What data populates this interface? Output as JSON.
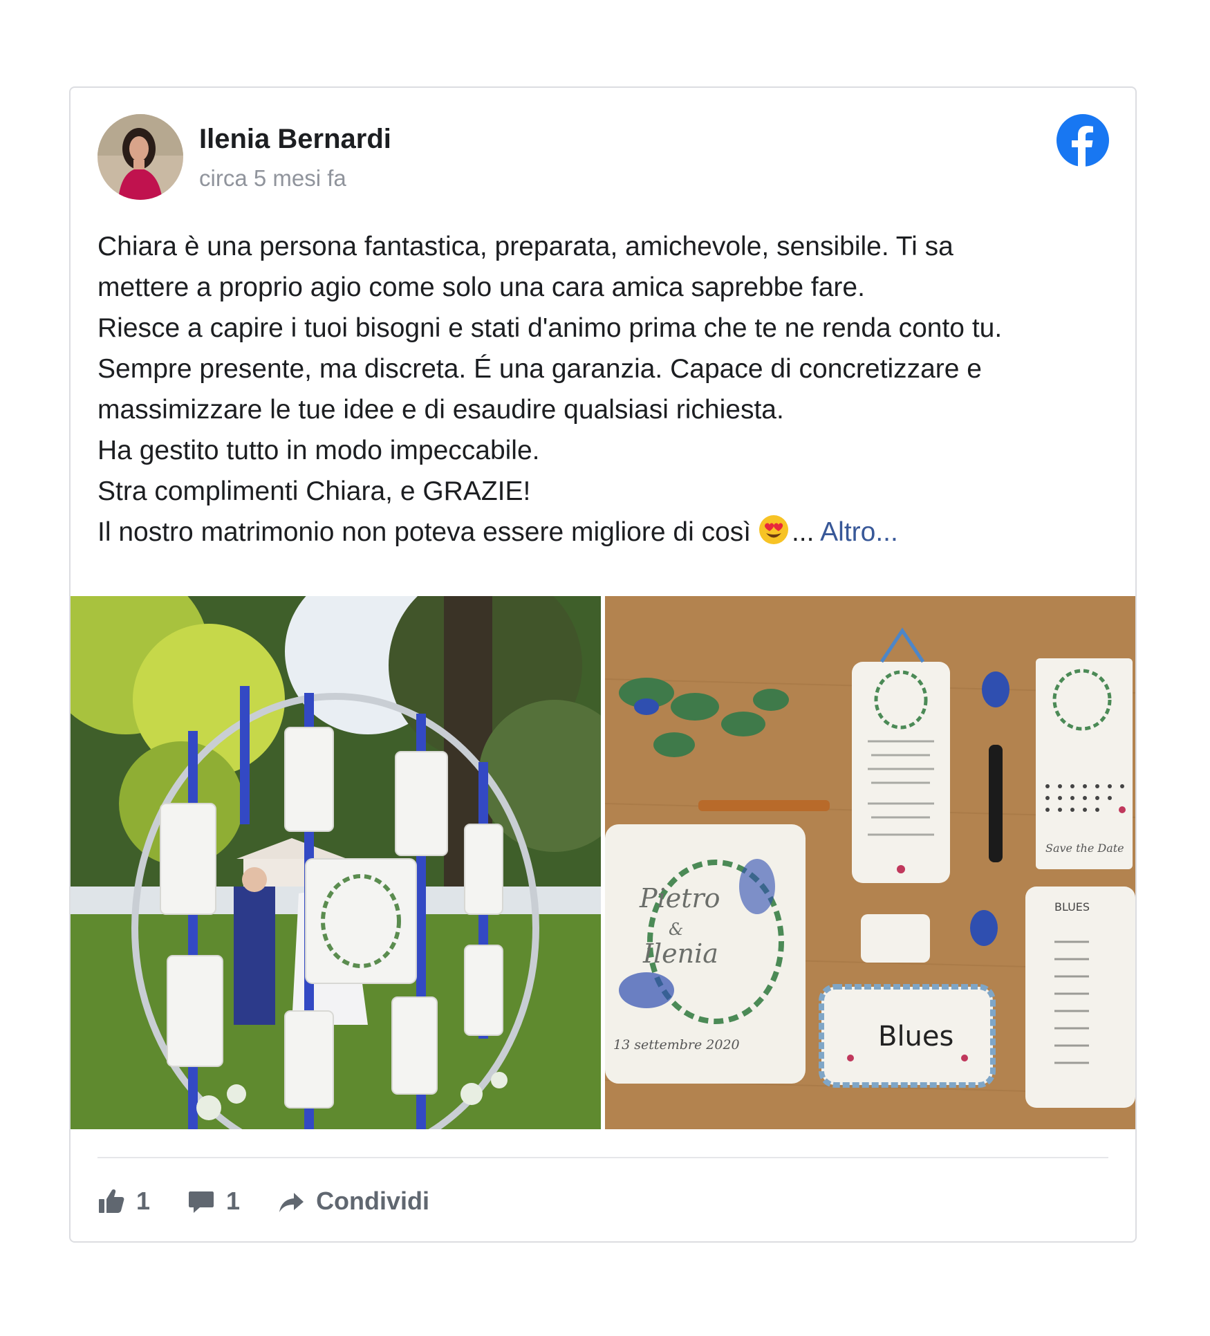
{
  "post": {
    "author_name": "Ilenia Bernardi",
    "timestamp": "circa 5 mesi fa",
    "platform_icon": "facebook-logo-icon",
    "text_lines": [
      "Chiara è una persona fantastica, preparata, amichevole, sensibile. Ti sa",
      "mettere a proprio agio come solo una cara amica saprebbe fare.",
      "Riesce a capire i tuoi bisogni e stati d'animo prima che te ne renda conto tu.",
      "Sempre presente, ma discreta. É una garanzia. Capace di concretizzare e",
      "massimizzare le tue idee e di esaudire qualsiasi richiesta.",
      "Ha gestito tutto in modo impeccabile.",
      "Stra complimenti Chiara, e GRAZIE!"
    ],
    "last_line": "Il nostro matrimonio non poteva essere migliore di così",
    "emoji_icon": "heart-eyes-emoji-icon",
    "ellipsis": "...",
    "more_label": "Altro...",
    "images": [
      {
        "description_icon": "wedding-seating-hoop-photo"
      },
      {
        "description_icon": "wedding-stationery-photo"
      }
    ]
  },
  "photo_text": {
    "names_line1": "Pietro",
    "names_amp": "&",
    "names_line2": "Ilenia",
    "date": "13 settembre 2020",
    "table_name": "Blues",
    "list_title": "BLUES",
    "save_the_date": "Save the Date"
  },
  "actions": {
    "likes_count": "1",
    "comments_count": "1",
    "share_label": "Condividi"
  },
  "colors": {
    "facebook_blue": "#1877f2",
    "link": "#385898",
    "muted": "#606770",
    "ribbon": "#2e46b8"
  }
}
